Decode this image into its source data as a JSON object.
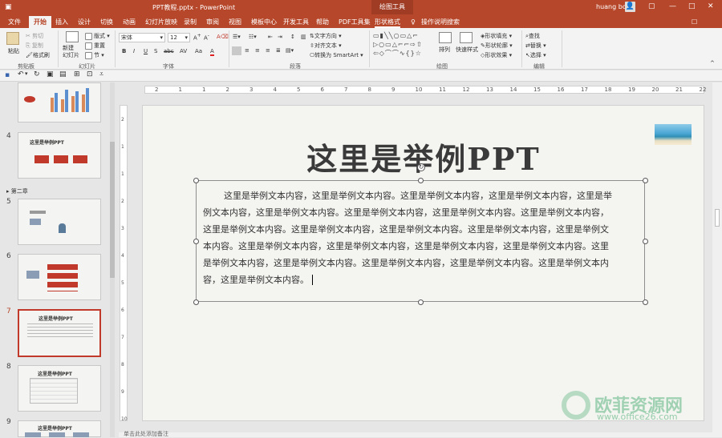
{
  "title_bar": {
    "document_title": "PPT教程.pptx  -  PowerPoint",
    "context_group": "绘图工具",
    "user_name": "huang bo",
    "restore_label": "▢",
    "minimize_label": "—",
    "maximize_label": "□",
    "close_label": "✕"
  },
  "tabs": [
    "文件",
    "开始",
    "插入",
    "设计",
    "切换",
    "动画",
    "幻灯片放映",
    "录制",
    "审阅",
    "视图",
    "模板中心",
    "开发工具",
    "帮助",
    "PDF工具集",
    "形状格式"
  ],
  "tell_me": "操作说明搜索",
  "ribbon": {
    "clipboard": {
      "paste": "粘贴",
      "cut": "剪切",
      "copy": "复制",
      "format_painter": "格式刷",
      "label": "剪贴板"
    },
    "slides": {
      "new_slide": "新建\n幻灯片",
      "layout": "版式",
      "reset": "重置",
      "section": "节",
      "label": "幻灯片"
    },
    "font": {
      "font_name": "宋体",
      "font_size": "12",
      "label": "字体",
      "bold": "B",
      "italic": "I",
      "underline": "U",
      "strike": "S",
      "shadow": "abc",
      "spacing": "AV",
      "case": "Aa",
      "color": "A"
    },
    "paragraph": {
      "text_direction": "文字方向",
      "align_text": "对齐文本",
      "smartart": "转换为 SmartArt",
      "label": "段落"
    },
    "drawing": {
      "arrange": "排列",
      "quick_styles": "快速样式",
      "fill": "形状填充",
      "outline": "形状轮廓",
      "effects": "形状效果",
      "label": "绘图"
    },
    "editing": {
      "find": "查找",
      "replace": "替换",
      "select": "选择",
      "label": "编辑"
    }
  },
  "ruler_labels": [
    "2",
    "1",
    "1",
    "2",
    "3",
    "4",
    "5",
    "6",
    "7",
    "8",
    "9",
    "10",
    "11",
    "12",
    "13",
    "14",
    "15",
    "16",
    "17",
    "18",
    "19",
    "20",
    "21",
    "22"
  ],
  "vruler_labels": [
    "2",
    "1",
    "1",
    "2",
    "3",
    "4",
    "5",
    "6",
    "7",
    "8",
    "9",
    "10"
  ],
  "thumbnails": [
    {
      "num": "4",
      "title": "这里是举例PPT"
    },
    {
      "section": "第二章"
    },
    {
      "num": "5",
      "title": ""
    },
    {
      "num": "6",
      "title": ""
    },
    {
      "num": "7",
      "title": "这里是举例PPT"
    },
    {
      "num": "8",
      "title": "这里是举例PPT"
    },
    {
      "num": "9",
      "title": "这里是举例PPT"
    }
  ],
  "slide": {
    "title": "这里是举例PPT",
    "body_lines": [
      "这里是举例文本内容，这里是举例文本内容。这里是举例文本内容，这里是举例文本内容，这里是举",
      "例文本内容，这里是举例文本内容。这里是举例文本内容，这里是举例文本内容。这里是举例文本内容，",
      "这里是举例文本内容。这里是举例文本内容，这里是举例文本内容。这里是举例文本内容，这里是举例文",
      "本内容。这里是举例文本内容，这里是举例文本内容，这里是举例文本内容，这里是举例文本内容。这里",
      "是举例文本内容，这里是举例文本内容。这里是举例文本内容，这里是举例文本内容。这里是举例文本内",
      "容，这里是举例文本内容。"
    ]
  },
  "status": {
    "notes": "单击此处添加备注"
  },
  "watermark": {
    "text": "欧菲资源网",
    "url": "www.office26.com"
  },
  "colors": {
    "accent": "#b7472a",
    "selection": "#c0392b"
  }
}
